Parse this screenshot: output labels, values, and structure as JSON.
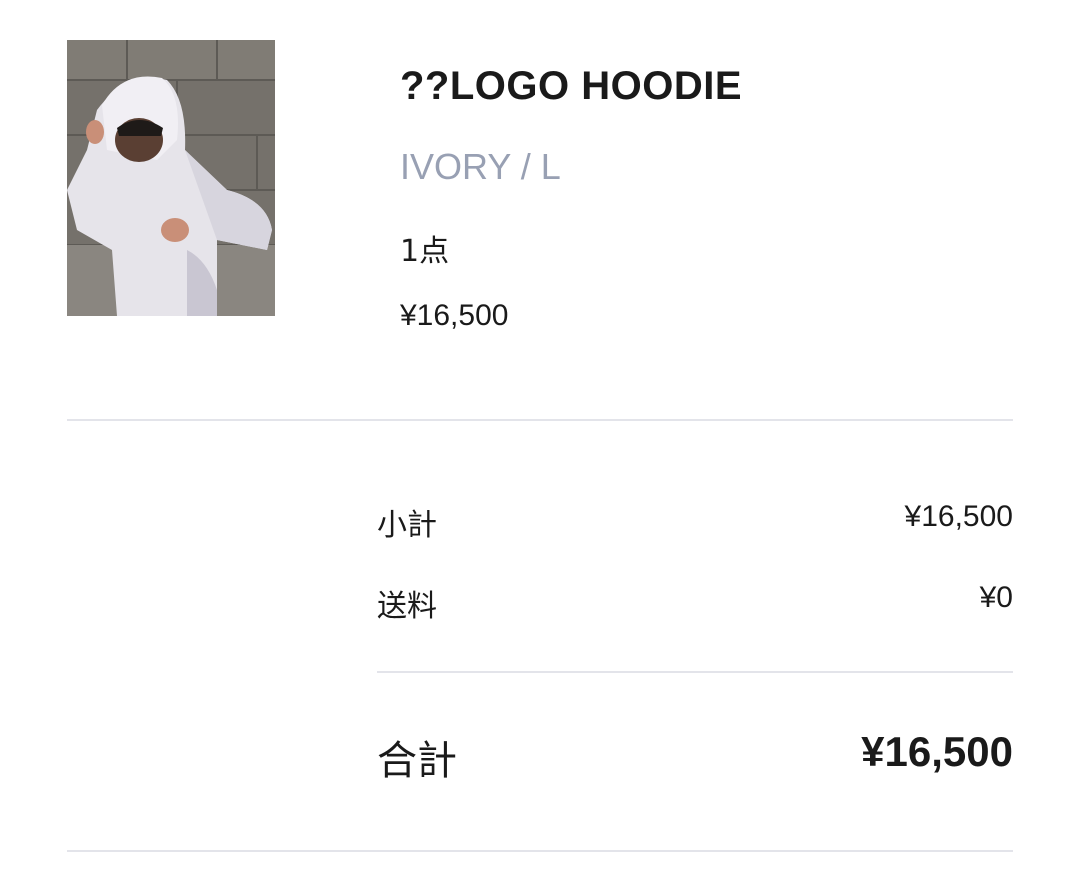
{
  "product": {
    "image_alt": "hoodie-photo",
    "name": "??LOGO HOODIE",
    "variant": "IVORY / L",
    "quantity": "1点",
    "price": "¥16,500"
  },
  "summary": {
    "subtotal": {
      "label": "小計",
      "value": "¥16,500"
    },
    "shipping": {
      "label": "送料",
      "value": "¥0"
    },
    "total": {
      "label": "合計",
      "value": "¥16,500"
    }
  },
  "colors": {
    "text": "#1a1a1a",
    "variant": "#98a0b3",
    "divider": "#e3e4ea"
  }
}
